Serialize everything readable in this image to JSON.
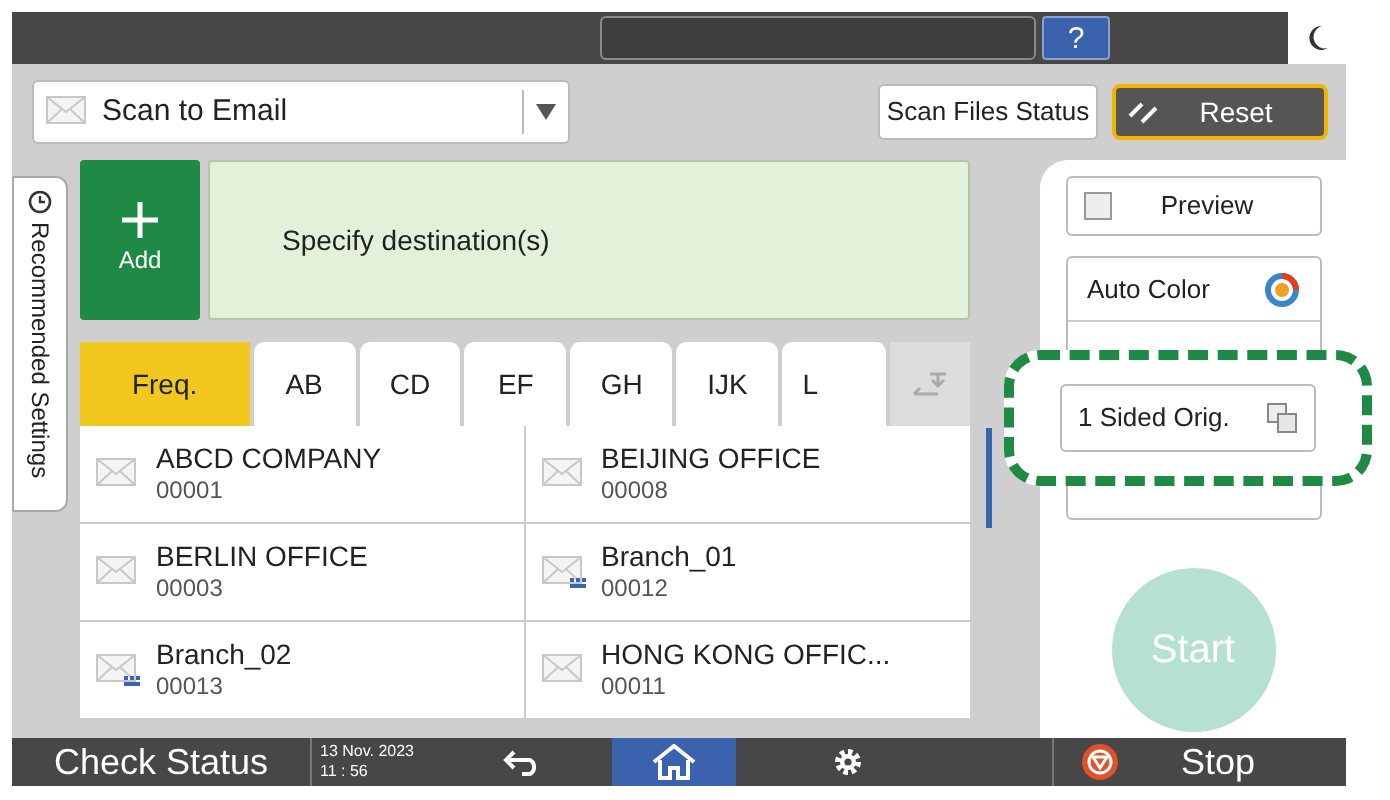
{
  "top_bar": {
    "help": "?"
  },
  "function_select": {
    "value": "Scan to Email"
  },
  "header_buttons": [
    {
      "label": "Scan Files Status",
      "kind": "plain"
    },
    {
      "label": "Reset",
      "kind": "reset"
    }
  ],
  "side_tab": {
    "label": "Recommended Settings"
  },
  "add_button": {
    "label": "Add"
  },
  "destination_banner": {
    "text": "Specify destination(s)"
  },
  "tabs": [
    {
      "label": "Freq.",
      "selected": true
    },
    {
      "label": "AB",
      "selected": false
    },
    {
      "label": "CD",
      "selected": false
    },
    {
      "label": "EF",
      "selected": false
    },
    {
      "label": "GH",
      "selected": false
    },
    {
      "label": "IJK",
      "selected": false
    },
    {
      "label": "L",
      "selected": false
    }
  ],
  "destinations": [
    {
      "name": "ABCD COMPANY",
      "number": "00001",
      "kind": "single"
    },
    {
      "name": "BEIJING OFFICE",
      "number": "00008",
      "kind": "single"
    },
    {
      "name": "BERLIN OFFICE",
      "number": "00003",
      "kind": "single"
    },
    {
      "name": "Branch_01",
      "number": "00012",
      "kind": "group"
    },
    {
      "name": "Branch_02",
      "number": "00013",
      "kind": "group"
    },
    {
      "name": "HONG KONG OFFIC...",
      "number": "00011",
      "kind": "single"
    }
  ],
  "preview": {
    "label": "Preview",
    "checked": false
  },
  "settings": [
    {
      "label": "Auto Color",
      "kind": "color"
    }
  ],
  "callout": {
    "label": "1 Sided Orig."
  },
  "start": {
    "label": "Start",
    "disabled": true
  },
  "bottom_bar": {
    "check_status": "Check Status",
    "date": "13 Nov. 2023",
    "time": "11 : 56",
    "stop": "Stop"
  }
}
